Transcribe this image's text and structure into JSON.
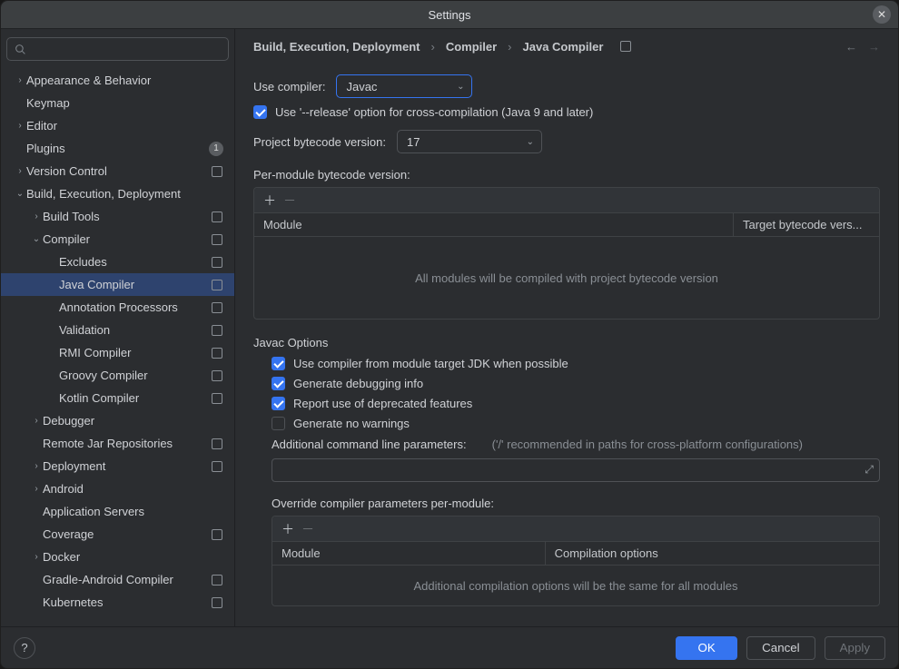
{
  "window": {
    "title": "Settings"
  },
  "search": {
    "placeholder": ""
  },
  "tree": [
    {
      "label": "Appearance & Behavior",
      "depth": 0,
      "expander": ">",
      "badge": null,
      "ext": false
    },
    {
      "label": "Keymap",
      "depth": 0,
      "expander": "",
      "badge": null,
      "ext": false
    },
    {
      "label": "Editor",
      "depth": 0,
      "expander": ">",
      "badge": null,
      "ext": false
    },
    {
      "label": "Plugins",
      "depth": 0,
      "expander": "",
      "badge": "1",
      "ext": false
    },
    {
      "label": "Version Control",
      "depth": 0,
      "expander": ">",
      "badge": null,
      "ext": true
    },
    {
      "label": "Build, Execution, Deployment",
      "depth": 0,
      "expander": "v",
      "badge": null,
      "ext": false
    },
    {
      "label": "Build Tools",
      "depth": 1,
      "expander": ">",
      "badge": null,
      "ext": true
    },
    {
      "label": "Compiler",
      "depth": 1,
      "expander": "v",
      "badge": null,
      "ext": true
    },
    {
      "label": "Excludes",
      "depth": 2,
      "expander": "",
      "badge": null,
      "ext": true
    },
    {
      "label": "Java Compiler",
      "depth": 2,
      "expander": "",
      "badge": null,
      "ext": true,
      "selected": true
    },
    {
      "label": "Annotation Processors",
      "depth": 2,
      "expander": "",
      "badge": null,
      "ext": true
    },
    {
      "label": "Validation",
      "depth": 2,
      "expander": "",
      "badge": null,
      "ext": true
    },
    {
      "label": "RMI Compiler",
      "depth": 2,
      "expander": "",
      "badge": null,
      "ext": true
    },
    {
      "label": "Groovy Compiler",
      "depth": 2,
      "expander": "",
      "badge": null,
      "ext": true
    },
    {
      "label": "Kotlin Compiler",
      "depth": 2,
      "expander": "",
      "badge": null,
      "ext": true
    },
    {
      "label": "Debugger",
      "depth": 1,
      "expander": ">",
      "badge": null,
      "ext": false
    },
    {
      "label": "Remote Jar Repositories",
      "depth": 1,
      "expander": "",
      "badge": null,
      "ext": true
    },
    {
      "label": "Deployment",
      "depth": 1,
      "expander": ">",
      "badge": null,
      "ext": true
    },
    {
      "label": "Android",
      "depth": 1,
      "expander": ">",
      "badge": null,
      "ext": false
    },
    {
      "label": "Application Servers",
      "depth": 1,
      "expander": "",
      "badge": null,
      "ext": false
    },
    {
      "label": "Coverage",
      "depth": 1,
      "expander": "",
      "badge": null,
      "ext": true
    },
    {
      "label": "Docker",
      "depth": 1,
      "expander": ">",
      "badge": null,
      "ext": false
    },
    {
      "label": "Gradle-Android Compiler",
      "depth": 1,
      "expander": "",
      "badge": null,
      "ext": true
    },
    {
      "label": "Kubernetes",
      "depth": 1,
      "expander": "",
      "badge": null,
      "ext": true
    }
  ],
  "crumbs": {
    "a": "Build, Execution, Deployment",
    "b": "Compiler",
    "c": "Java Compiler"
  },
  "form": {
    "use_compiler_label": "Use compiler:",
    "use_compiler_value": "Javac",
    "release_option": "Use '--release' option for cross-compilation (Java 9 and later)",
    "project_bytecode_label": "Project bytecode version:",
    "project_bytecode_value": "17",
    "per_module_label": "Per-module bytecode version:",
    "module_col": "Module",
    "target_col": "Target bytecode vers...",
    "module_empty": "All modules will be compiled with project bytecode version",
    "javac_title": "Javac Options",
    "opt_module_jdk": "Use compiler from module target JDK when possible",
    "opt_debug": "Generate debugging info",
    "opt_deprecated": "Report use of deprecated features",
    "opt_no_warnings": "Generate no warnings",
    "addl_params_label": "Additional command line parameters:",
    "addl_params_hint": "('/' recommended in paths for cross-platform configurations)",
    "override_label": "Override compiler parameters per-module:",
    "override_module_col": "Module",
    "override_opts_col": "Compilation options",
    "override_empty": "Additional compilation options will be the same for all modules"
  },
  "footer": {
    "ok": "OK",
    "cancel": "Cancel",
    "apply": "Apply"
  }
}
